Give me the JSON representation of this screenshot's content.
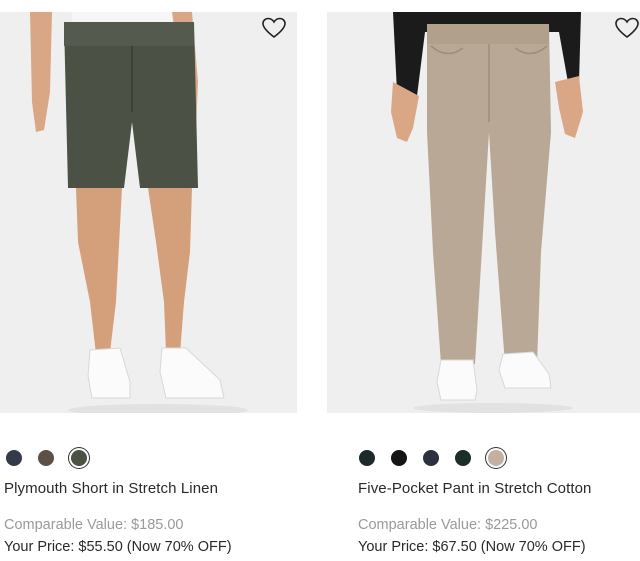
{
  "products": [
    {
      "name": "Plymouth Short in Stretch Linen",
      "comparable_value": "Comparable Value: $185.00",
      "your_price": "Your Price: $55.50 (Now 70% OFF)",
      "image_subject": "shorts-on-model",
      "swatches": [
        {
          "color": "#333a4a",
          "selected": false
        },
        {
          "color": "#5d5046",
          "selected": false
        },
        {
          "color": "#4a5344",
          "selected": true
        }
      ]
    },
    {
      "name": "Five-Pocket Pant in Stretch Cotton",
      "comparable_value": "Comparable Value: $225.00",
      "your_price": "Your Price: $67.50 (Now 70% OFF)",
      "image_subject": "pants-on-model",
      "swatches": [
        {
          "color": "#1e2a2a",
          "selected": false
        },
        {
          "color": "#151515",
          "selected": false
        },
        {
          "color": "#2c3140",
          "selected": false
        },
        {
          "color": "#1b2e28",
          "selected": false
        },
        {
          "color": "#c1b19e",
          "selected": true
        }
      ]
    }
  ]
}
